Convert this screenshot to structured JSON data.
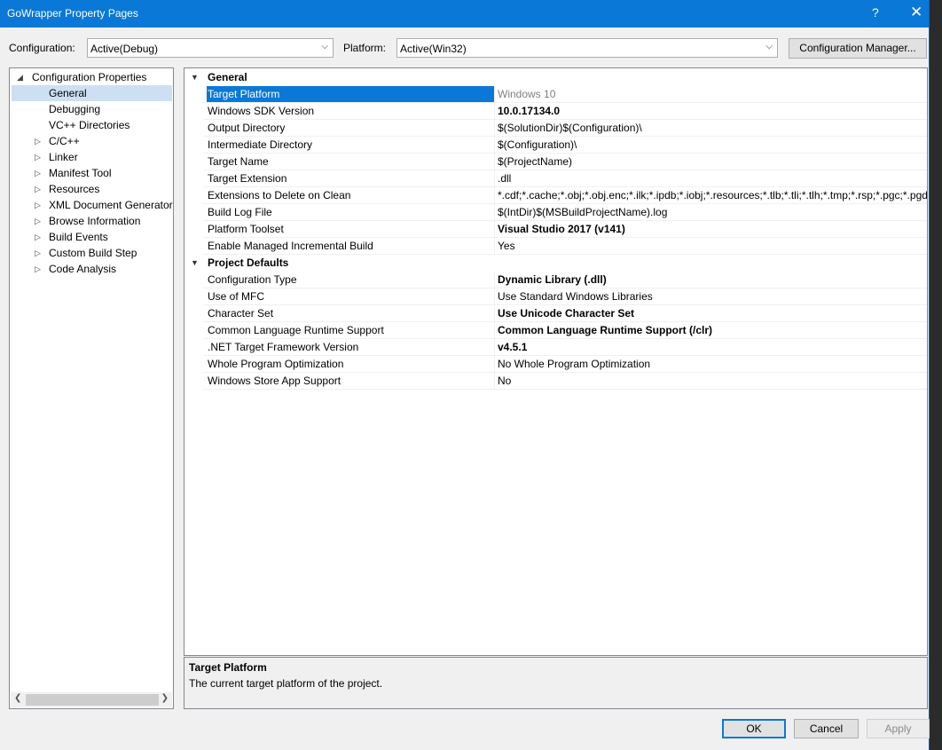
{
  "window": {
    "title": "GoWrapper Property Pages",
    "help": "?",
    "close": "✕"
  },
  "toolbar": {
    "configuration_label": "Configuration:",
    "configuration_value": "Active(Debug)",
    "platform_label": "Platform:",
    "platform_value": "Active(Win32)",
    "config_manager_button": "Configuration Manager..."
  },
  "tree": {
    "root": "Configuration Properties",
    "items": [
      "General",
      "Debugging",
      "VC++ Directories",
      "C/C++",
      "Linker",
      "Manifest Tool",
      "Resources",
      "XML Document Generator",
      "Browse Information",
      "Build Events",
      "Custom Build Step",
      "Code Analysis"
    ]
  },
  "grid": {
    "general": {
      "header": "General",
      "rows": [
        {
          "name": "Target Platform",
          "value": "Windows 10"
        },
        {
          "name": "Windows SDK Version",
          "value": "10.0.17134.0"
        },
        {
          "name": "Output Directory",
          "value": "$(SolutionDir)$(Configuration)\\"
        },
        {
          "name": "Intermediate Directory",
          "value": "$(Configuration)\\"
        },
        {
          "name": "Target Name",
          "value": "$(ProjectName)"
        },
        {
          "name": "Target Extension",
          "value": ".dll"
        },
        {
          "name": "Extensions to Delete on Clean",
          "value": "*.cdf;*.cache;*.obj;*.obj.enc;*.ilk;*.ipdb;*.iobj;*.resources;*.tlb;*.tli;*.tlh;*.tmp;*.rsp;*.pgc;*.pgd"
        },
        {
          "name": "Build Log File",
          "value": "$(IntDir)$(MSBuildProjectName).log"
        },
        {
          "name": "Platform Toolset",
          "value": "Visual Studio 2017 (v141)"
        },
        {
          "name": "Enable Managed Incremental Build",
          "value": "Yes"
        }
      ]
    },
    "project_defaults": {
      "header": "Project Defaults",
      "rows": [
        {
          "name": "Configuration Type",
          "value": "Dynamic Library (.dll)"
        },
        {
          "name": "Use of MFC",
          "value": "Use Standard Windows Libraries"
        },
        {
          "name": "Character Set",
          "value": "Use Unicode Character Set"
        },
        {
          "name": "Common Language Runtime Support",
          "value": "Common Language Runtime Support (/clr)"
        },
        {
          "name": ".NET Target Framework Version",
          "value": "v4.5.1"
        },
        {
          "name": "Whole Program Optimization",
          "value": "No Whole Program Optimization"
        },
        {
          "name": "Windows Store App Support",
          "value": "No"
        }
      ]
    }
  },
  "description": {
    "title": "Target Platform",
    "text": "The current target platform of the project."
  },
  "buttons": {
    "ok": "OK",
    "cancel": "Cancel",
    "apply": "Apply"
  }
}
